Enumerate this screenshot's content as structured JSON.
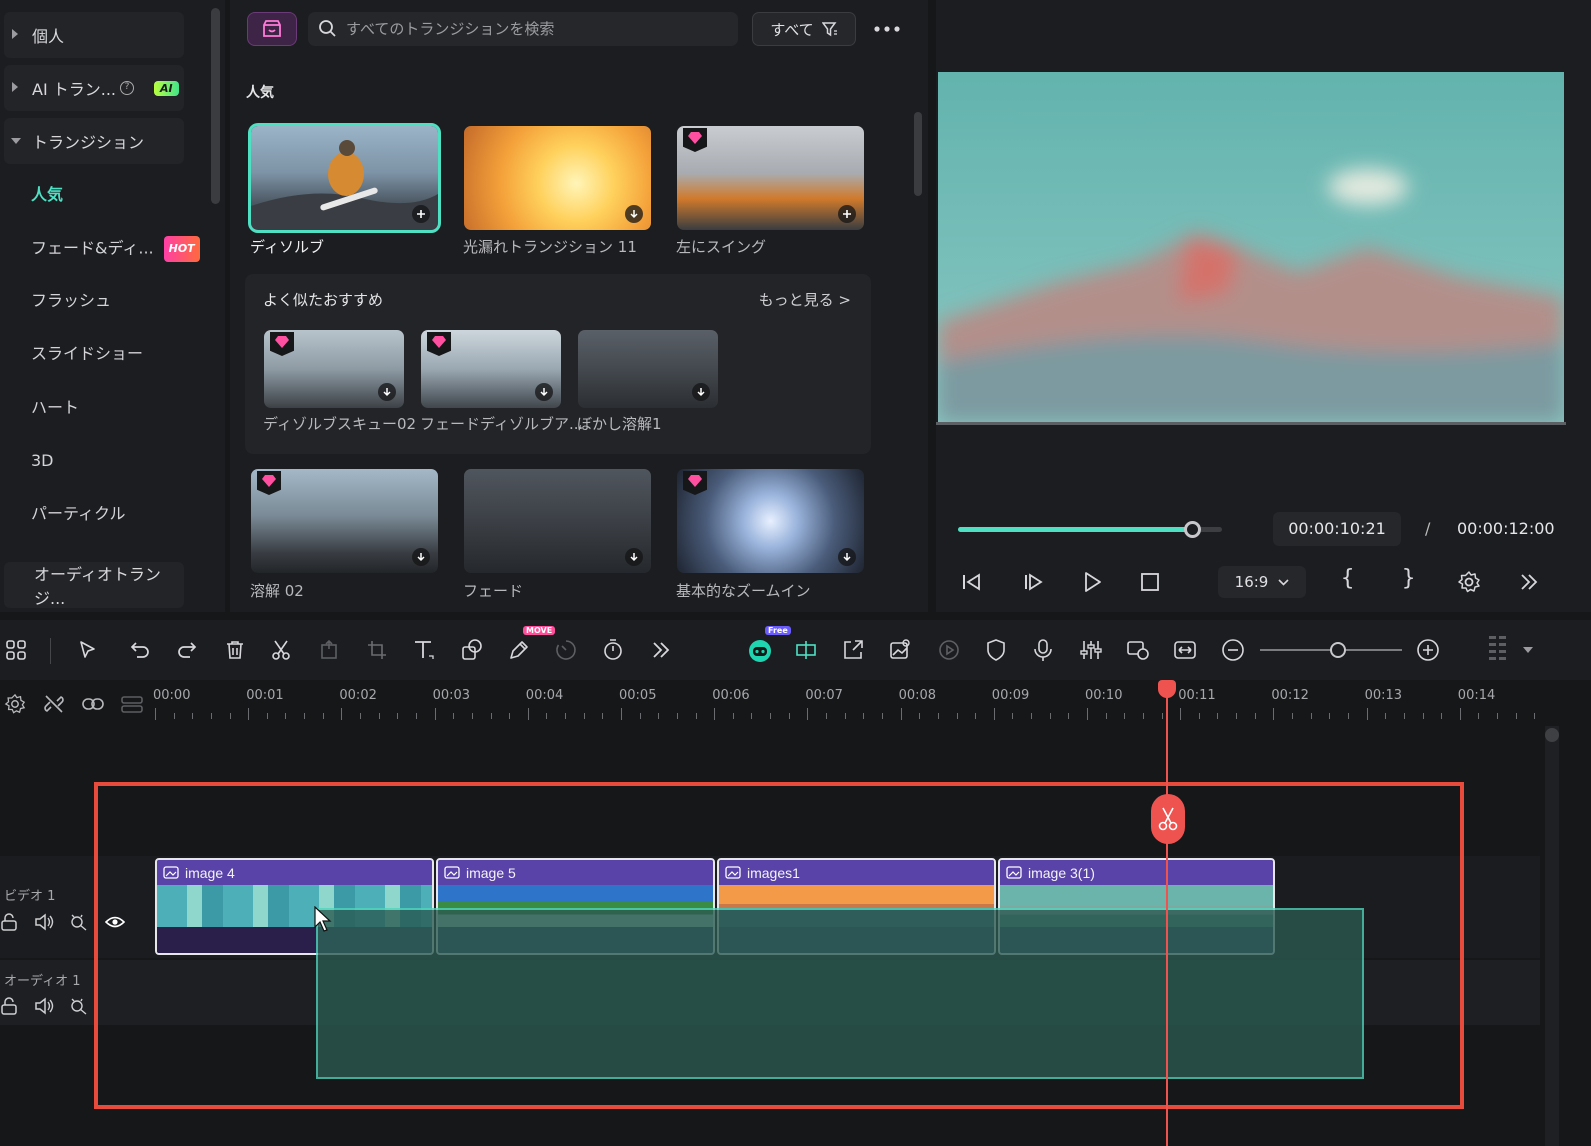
{
  "sidebar": {
    "headers": [
      {
        "label": "個人",
        "expanded": false
      },
      {
        "label": "AI トラン...",
        "badge": "AI",
        "expanded": false
      },
      {
        "label": "トランジション",
        "expanded": true
      }
    ],
    "items": [
      {
        "label": "人気",
        "active": true
      },
      {
        "label": "フェード&ディ...",
        "badge": "HOT"
      },
      {
        "label": "フラッシュ"
      },
      {
        "label": "スライドショー"
      },
      {
        "label": "ハート"
      },
      {
        "label": "3D"
      },
      {
        "label": "パーティクル"
      }
    ],
    "audio_header": "オーディオトランジ..."
  },
  "library": {
    "search_placeholder": "すべてのトランジションを検索",
    "filter_label": "すべて",
    "section_popular": "人気",
    "popular": [
      {
        "label": "ディソルブ",
        "selected": true,
        "premium": false
      },
      {
        "label": "光漏れトランジション 11",
        "premium": false
      },
      {
        "label": "左にスイング",
        "premium": true
      }
    ],
    "similar": {
      "title": "よく似たおすすめ",
      "more": "もっと見る >",
      "items": [
        {
          "label": "ディゾルブスキュー02",
          "premium": true
        },
        {
          "label": "フェードディゾルブア...",
          "premium": true
        },
        {
          "label": "ぼかし溶解1",
          "premium": false
        }
      ]
    },
    "row2": [
      {
        "label": "溶解 02",
        "premium": true
      },
      {
        "label": "フェード",
        "premium": false
      },
      {
        "label": "基本的なズームイン",
        "premium": true
      }
    ]
  },
  "preview": {
    "progress": 0.886,
    "current_time": "00:00:10:21",
    "separator": "/",
    "total_time": "00:00:12:00",
    "ratio": "16:9"
  },
  "toolbar": {
    "badge_move": "MOVE",
    "badge_free": "Free",
    "zoom_level": 0.55
  },
  "timeline": {
    "ruler": [
      "00:00",
      "00:01",
      "00:02",
      "00:03",
      "00:04",
      "00:05",
      "00:06",
      "00:07",
      "00:08",
      "00:09",
      "00:10",
      "00:11",
      "00:12",
      "00:13",
      "00:14"
    ],
    "tracks": {
      "video": "ビデオ 1",
      "audio": "オーディオ 1"
    },
    "clips": [
      {
        "name": "image 4"
      },
      {
        "name": "image 5"
      },
      {
        "name": "images1"
      },
      {
        "name": "image 3(1)"
      }
    ]
  },
  "colors": {
    "accent": "#4fe0c4",
    "playhead": "#ef5350",
    "clip_header": "#5943a8",
    "highlight": "#e84a3b"
  }
}
